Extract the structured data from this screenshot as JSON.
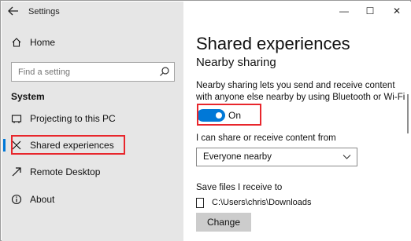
{
  "window": {
    "title": "Settings",
    "back_icon": "arrow-left-icon",
    "controls": {
      "minimize": "—",
      "maximize": "☐",
      "close": "✕"
    }
  },
  "sidebar": {
    "home": {
      "label": "Home",
      "icon": "home-icon"
    },
    "search": {
      "placeholder": "Find a setting",
      "icon": "search-icon"
    },
    "section": "System",
    "items": [
      {
        "label": "Projecting to this PC",
        "icon": "projector-icon",
        "selected": false
      },
      {
        "label": "Shared experiences",
        "icon": "shared-experiences-icon",
        "selected": true
      },
      {
        "label": "Remote Desktop",
        "icon": "remote-desktop-icon",
        "selected": false
      },
      {
        "label": "About",
        "icon": "info-icon",
        "selected": false
      }
    ]
  },
  "main": {
    "page_title": "Shared experiences",
    "subtitle": "Nearby sharing",
    "description": "Nearby sharing lets you send and receive content with anyone else nearby by using Bluetooth or Wi-Fi",
    "toggle": {
      "state_label": "On",
      "checked": true
    },
    "share_label": "I can share or receive content from",
    "dropdown": {
      "value": "Everyone nearby"
    },
    "save_label": "Save files I receive to",
    "save_path": "C:\\Users\\chris\\Downloads",
    "change_button": "Change"
  },
  "colors": {
    "accent": "#0078d7",
    "highlight": "#e8262c",
    "sidebar_bg": "#e6e6e6"
  }
}
